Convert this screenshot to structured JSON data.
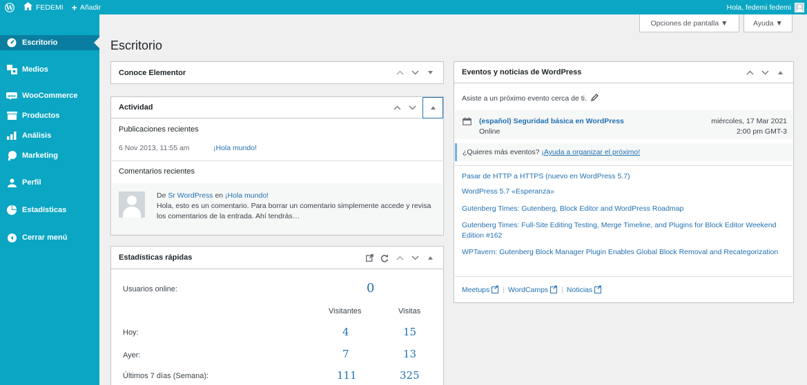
{
  "colors": {
    "brand": "#0aa6c3",
    "brand_dark": "#0a7ea0",
    "link": "#2271b1",
    "bg": "#f0f0f1"
  },
  "adminbar": {
    "site_name": "FEDEMI",
    "new_label": "Añadir",
    "greeting": "Hola, fedemi fedemi"
  },
  "sidebar": {
    "items": [
      {
        "label": "Escritorio",
        "icon": "dashboard-icon",
        "current": true
      },
      {
        "label": "Medios",
        "icon": "media-icon"
      },
      {
        "label": "WooCommerce",
        "icon": "woocommerce-icon"
      },
      {
        "label": "Productos",
        "icon": "products-icon"
      },
      {
        "label": "Análisis",
        "icon": "analytics-icon"
      },
      {
        "label": "Marketing",
        "icon": "marketing-icon"
      },
      {
        "label": "Perfil",
        "icon": "profile-icon"
      },
      {
        "label": "Estadísticas",
        "icon": "stats-icon"
      },
      {
        "label": "Cerrar menú",
        "icon": "collapse-icon"
      }
    ]
  },
  "screen_options": {
    "options_label": "Opciones de pantalla ▼",
    "help_label": "Ayuda ▼"
  },
  "page": {
    "title": "Escritorio"
  },
  "elementor": {
    "title": "Conoce Elementor"
  },
  "activity": {
    "title": "Actividad",
    "recent_posts_heading": "Publicaciones recientes",
    "post_date": "6 Nov 2013, 11:55 am",
    "post_title": "¡Hola mundo!",
    "recent_comments_heading": "Comentarios recientes",
    "comment_prefix": "De",
    "comment_author": "Sr WordPress",
    "comment_in": "en",
    "comment_post": "¡Hola mundo!",
    "comment_text": "Hola, esto es un comentario. Para borrar un comentario simplemente accede y revisa los comentarios de la entrada. Ahí tendrás…"
  },
  "quick_stats": {
    "title": "Estadísticas rápidas",
    "online_label": "Usuarios online:",
    "online_value": "0",
    "col_visitors": "Visitantes",
    "col_visits": "Visitas",
    "rows": [
      {
        "label": "Hoy:",
        "visitors": "4",
        "visits": "15"
      },
      {
        "label": "Ayer:",
        "visitors": "7",
        "visits": "13"
      },
      {
        "label": "Últimos 7 días (Semana):",
        "visitors": "111",
        "visits": "325"
      }
    ]
  },
  "events": {
    "title": "Eventos y noticias de WordPress",
    "nearby_text": "Asiste a un próximo evento cerca de ti.",
    "event_title": "(español) Seguridad básica en WordPress",
    "event_location": "Online",
    "event_date": "miércoles, 17 Mar 2021",
    "event_time": "2:00 pm GMT-3",
    "more_events_text": "¿Quieres más eventos?",
    "more_events_link": "¡Ayuda a organizar el próximo!",
    "news": [
      "Pasar de HTTP a HTTPS (nuevo en WordPress 5.7)",
      "WordPress 5.7 «Esperanza»",
      "Gutenberg Times: Gutenberg, Block Editor and WordPress Roadmap",
      "Gutenberg Times: Full-Site Editing Testing, Merge Timeline, and Plugins for Block Editor Weekend Edition #162",
      "WPTavern: Gutenberg Block Manager Plugin Enables Global Block Removal and Recategorization"
    ],
    "footer_meetups": "Meetups",
    "footer_wordcamps": "WordCamps",
    "footer_news": "Noticias"
  }
}
